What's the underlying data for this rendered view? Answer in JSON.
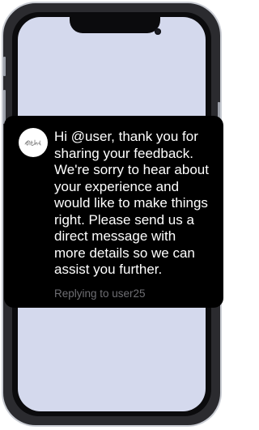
{
  "reply": {
    "message": "Hi @user, thank you for\nsharing your feedback.\nWe're sorry to hear about\nyour experience and\nwould like to make things\nright. Please send us a\ndirect message with\nmore details so we can\nassist you further.",
    "replying_to": "Replying to user25",
    "avatar_icon": "brand-logo-icon"
  },
  "colors": {
    "screen_background": "#d4d9ed",
    "card_background": "#000000",
    "message_text": "#ffffff",
    "meta_text": "#6e6e73"
  }
}
